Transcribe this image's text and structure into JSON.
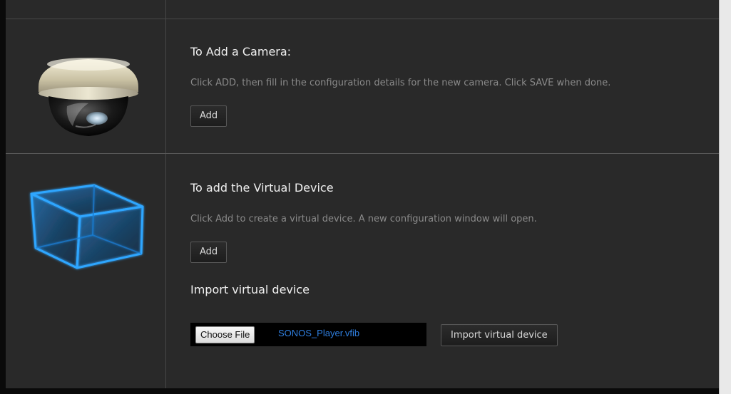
{
  "camera_section": {
    "title": "To Add a Camera:",
    "description": "Click ADD, then fill in the configuration details for the new camera. Click SAVE when done.",
    "add_label": "Add"
  },
  "virtual_section": {
    "title": "To add the Virtual Device",
    "description": "Click Add to create a virtual device. A new configuration window will open.",
    "add_label": "Add",
    "import_title": "Import virtual device",
    "choose_file_label": "Choose File",
    "selected_file": "SONOS_Player.vfib",
    "import_button_label": "Import virtual device"
  },
  "icons": {
    "camera": "dome-camera-icon",
    "virtual_device": "wireframe-cube-icon"
  },
  "colors": {
    "background": "#292929",
    "title_text": "#f0f0f0",
    "description_text": "#8a8a8a",
    "file_name_text": "#2f7fe0",
    "cube_glow": "#1e9bff"
  }
}
